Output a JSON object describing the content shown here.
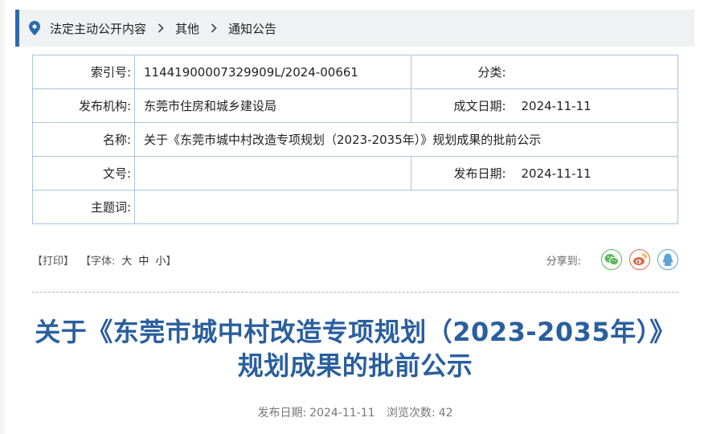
{
  "breadcrumb": {
    "items": [
      "法定主动公开内容",
      "其他",
      "通知公告"
    ]
  },
  "meta": {
    "index_label": "索引号:",
    "index_value": "11441900007329909L/2024-00661",
    "category_label": "分类:",
    "category_value": "",
    "org_label": "发布机构:",
    "org_value": "东莞市住房和城乡建设局",
    "created_label": "成文日期:",
    "created_value": "2024-11-11",
    "name_label": "名称:",
    "name_value": "关于《东莞市城中村改造专项规划（2023-2035年）》规划成果的批前公示",
    "docno_label": "文号:",
    "docno_value": "",
    "published_label": "发布日期:",
    "published_value": "2024-11-11",
    "keywords_label": "主题词:",
    "keywords_value": ""
  },
  "toolbar": {
    "print": "【打印】",
    "font_label": "【字体:",
    "font_large": "大",
    "font_medium": "中",
    "font_small": "小",
    "font_close": "】",
    "share_label": "分享到:"
  },
  "share_icons": [
    "wechat-icon",
    "weibo-icon",
    "qq-icon"
  ],
  "colors": {
    "accent": "#2a6bb0",
    "title": "#2a5f9e",
    "table_border": "#a9c4dc",
    "wechat": "#5cb85c",
    "weibo": "#e06a4a",
    "qq": "#5aa6d6"
  },
  "article": {
    "title_line1": "关于《东莞市城中村改造专项规划（2023-2035年）》",
    "title_line2": "规划成果的批前公示",
    "pub_date_label": "发布日期:",
    "pub_date": "2024-11-11",
    "views_label": "浏览次数:",
    "views": "42"
  }
}
